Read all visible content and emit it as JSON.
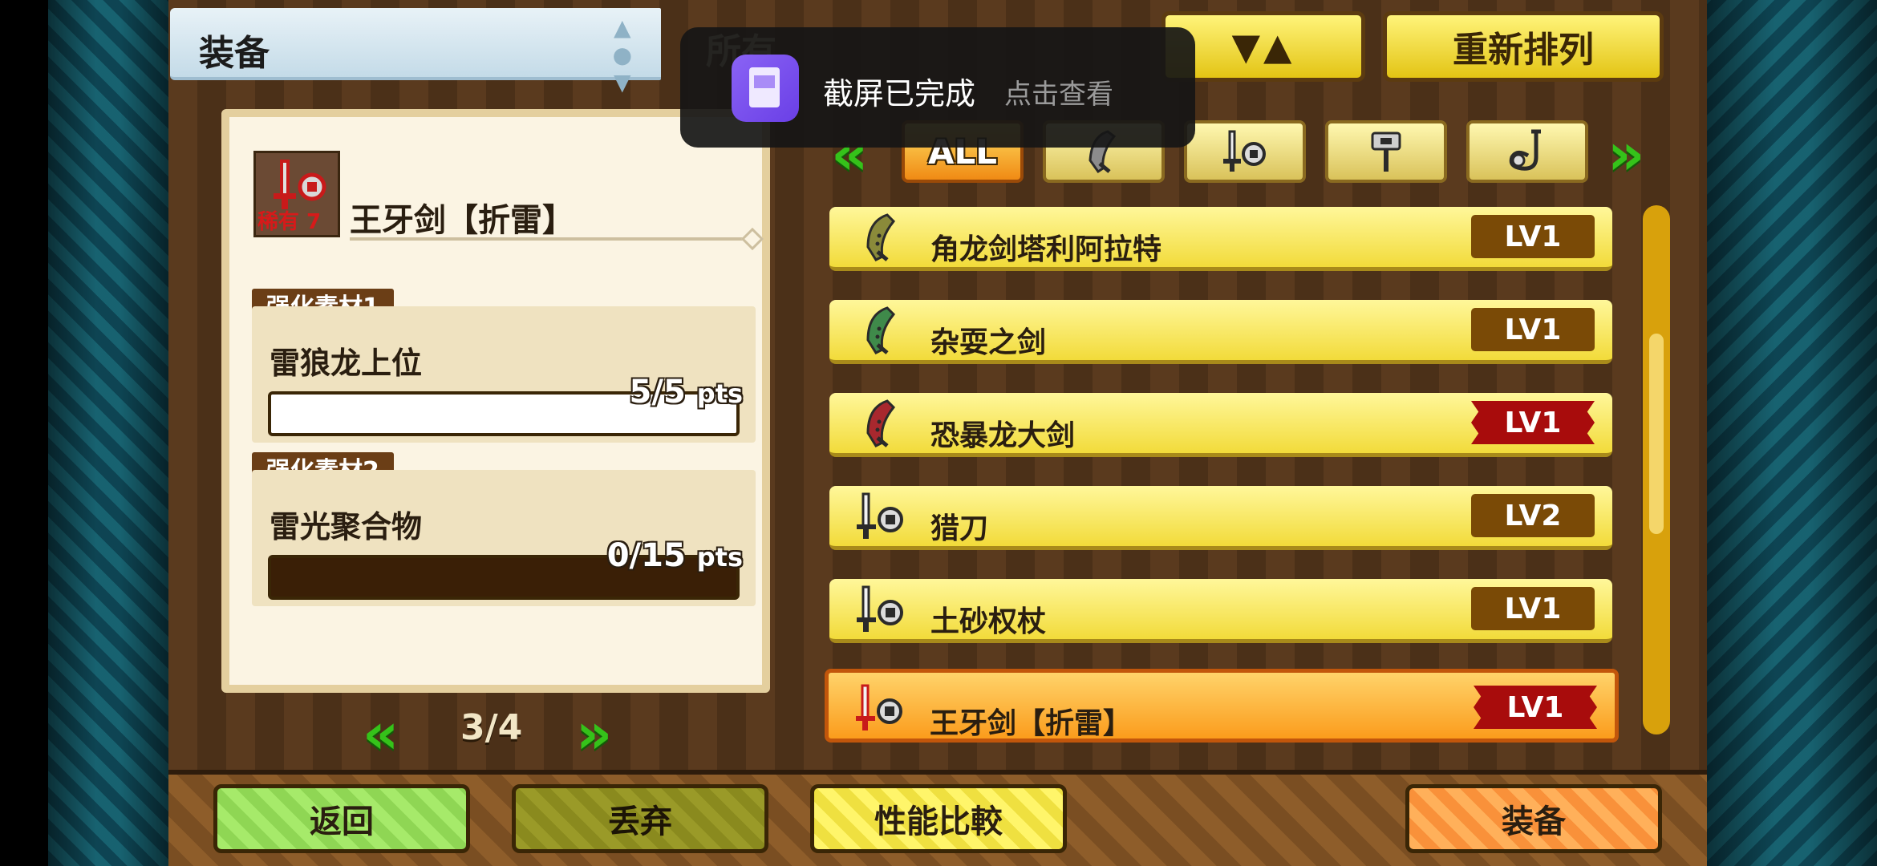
{
  "header": {
    "title": "装备",
    "filter_label": "所有",
    "sort_label": "▼▲",
    "rearrange_label": "重新排列"
  },
  "tabs": [
    {
      "label": "ALL",
      "icon": "all-icon",
      "active": true
    },
    {
      "label": "",
      "icon": "great-sword-icon"
    },
    {
      "label": "",
      "icon": "sword-and-shield-icon"
    },
    {
      "label": "",
      "icon": "hammer-icon"
    },
    {
      "label": "",
      "icon": "hunting-horn-icon"
    }
  ],
  "detail": {
    "rarity": "稀有 7",
    "name": "王牙剑【折雷】",
    "materials": [
      {
        "tag": "强化素材1",
        "name": "雷狼龙上位",
        "pts": "5/5",
        "unit": "pts",
        "progress": 1.0
      },
      {
        "tag": "强化素材2",
        "name": "雷光聚合物",
        "pts": "0/15",
        "unit": "pts",
        "progress": 0.0
      }
    ]
  },
  "pager": {
    "text": "3/4"
  },
  "equipment_list": [
    {
      "name": "角龙剑塔利阿拉特",
      "level": "LV1",
      "icon": "great-sword-icon",
      "color": "#8a8a3a",
      "maxed": false
    },
    {
      "name": "杂耍之剑",
      "level": "LV1",
      "icon": "great-sword-icon",
      "color": "#3f8a4a",
      "maxed": false
    },
    {
      "name": "恐暴龙大剑",
      "level": "LV1",
      "icon": "great-sword-icon",
      "color": "#a8282e",
      "maxed": true
    },
    {
      "name": "猎刀",
      "level": "LV2",
      "icon": "sword-and-shield-icon",
      "color": "#2a2a2a",
      "maxed": false
    },
    {
      "name": "土砂权杖",
      "level": "LV1",
      "icon": "sword-and-shield-icon",
      "color": "#2a2a2a",
      "maxed": false
    },
    {
      "name": "王牙剑【折雷】",
      "level": "LV1",
      "icon": "sword-and-shield-icon",
      "color": "#c81a1a",
      "maxed": true,
      "selected": true
    }
  ],
  "buttons": {
    "back": "返回",
    "discard": "丢弃",
    "compare": "性能比較",
    "equip": "装备"
  },
  "notification": {
    "title": "截屏已完成",
    "action": "点击查看"
  }
}
